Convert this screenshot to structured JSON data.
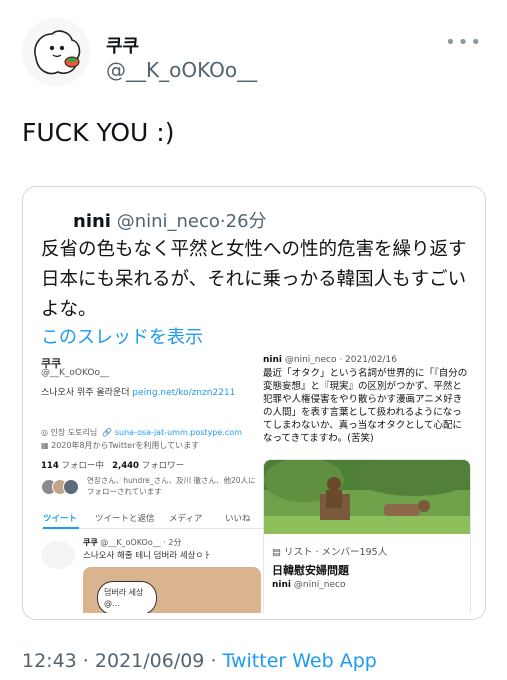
{
  "author": {
    "display_name": "쿠쿠",
    "handle": "@__K_oOKOo__"
  },
  "tweet": {
    "text": "FUCK YOU :)"
  },
  "quoted": {
    "name": "nini",
    "handle": "@nini_neco",
    "separator": "·",
    "time": "26分",
    "text": "反省の色もなく平然と女性への性的危害を繰り返す日本にも呆れるが、それに乗っかる韓国人もすごいよな。",
    "show_thread": "このスレッドを表示",
    "screenshot_left": {
      "name": "쿠쿠",
      "handle": "@__K_oOKOo__",
      "bio_text": "스나오사 위주 올라운더 ",
      "bio_link": "peing.net/ko/znzn2211",
      "location": "인장 도토리님",
      "website": "suna-osa-jat-umm.postype.com",
      "joined": "2020年8月からTwitterを利用しています",
      "following_count": "114",
      "following_label": "フォロー中",
      "followers_count": "2,440",
      "followers_label": "フォロワー",
      "known_followers": "연장さん、hundre_さん、及川 徹さん、他20人にフォローされています",
      "tabs": [
        "ツイート",
        "ツイートと返信",
        "メディア",
        "いいね"
      ],
      "tweet_name": "쿠쿠",
      "tweet_meta": "@__K_oOKOo__ · 2分",
      "tweet_text": "스나오사 해줄 테니 덤버라 세상ㅇㅏ",
      "tweet_image_text": "덤버라 세상 @..."
    },
    "screenshot_right": {
      "name": "nini",
      "meta": "@nini_neco · 2021/02/16",
      "text": "最近「オタク」という名詞が世界的に「『自分の変態妄想』と『現実』の区別がつかず、平然と犯罪や人権侵害をやり散らかす漫画アニメ好きの人間」を表す言葉として扱われるようになってしまわないか、真っ当なオタクとして心配になってきてますわ。(苦笑)",
      "list_label": "リスト · メンバー195人",
      "list_title": "日韓慰安婦問題",
      "list_owner_name": "nini",
      "list_owner_handle": "@nini_neco"
    }
  },
  "meta": {
    "time": "12:43",
    "separator1": " · ",
    "date": "2021/06/09",
    "separator2": " · ",
    "app": "Twitter Web App"
  },
  "icons": [
    "more-icon",
    "avatar-mascot",
    "list-icon",
    "location-icon",
    "link-icon",
    "calendar-icon"
  ],
  "colors": {
    "link": "#1d9bf0",
    "muted": "#536471",
    "text": "#0f1419",
    "border": "#cfd9de"
  }
}
